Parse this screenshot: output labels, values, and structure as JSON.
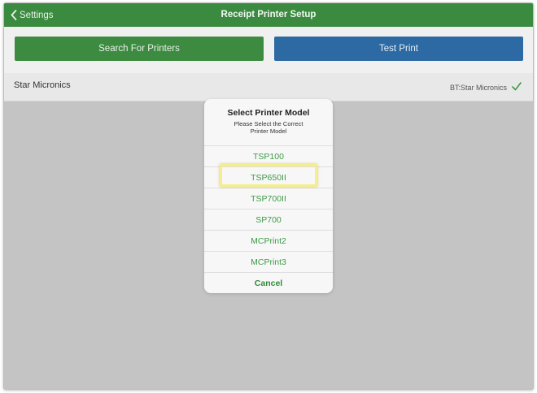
{
  "nav": {
    "back_label": "Settings",
    "title": "Receipt Printer Setup"
  },
  "toolbar": {
    "search_label": "Search For Printers",
    "test_label": "Test Print"
  },
  "printer": {
    "name": "Star Micronics",
    "connection": "BT:Star Micronics",
    "selected_icon": "checkmark-icon"
  },
  "dialog": {
    "title": "Select Printer Model",
    "message": "Please Select the Correct Printer Model",
    "options": [
      "TSP100",
      "TSP650II",
      "TSP700II",
      "SP700",
      "MCPrint2",
      "MCPrint3"
    ],
    "cancel_label": "Cancel",
    "highlighted_option": "TSP650II"
  },
  "colors": {
    "nav": "#3a8a3f",
    "search_button": "#3d8b40",
    "test_button": "#2d6aa3",
    "option_text": "#3d9a45",
    "highlight": "#f6ee8e"
  }
}
